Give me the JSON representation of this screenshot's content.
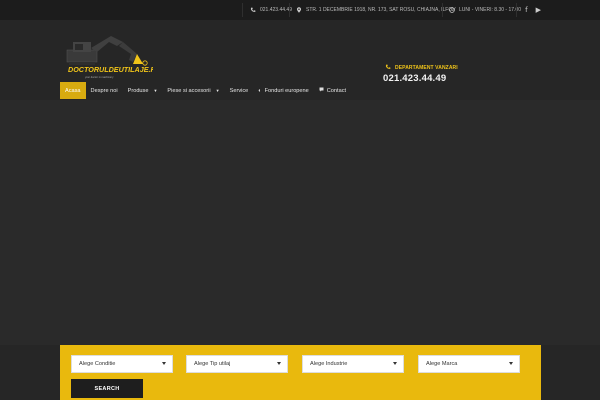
{
  "topbar": {
    "phone": "021.423.44.49",
    "address": "STR. 1 DECEMBRIE 1918, NR. 173, SAT ROSU, CHIAJNA, ILFOV",
    "hours": "LUNI - VINERI: 8.30 - 17.00",
    "social": [
      {
        "icon": "facebook-icon",
        "glyph": "f"
      },
      {
        "icon": "youtube-icon",
        "glyph": "▶"
      }
    ]
  },
  "header": {
    "logo_text": "DOCTORULDEUTILAJE.RO",
    "logo_tagline": "your doctor in machinery",
    "department_label": "DEPARTAMENT VANZARI",
    "department_phone": "021.423.44.49"
  },
  "nav": {
    "items": [
      {
        "label": "Acasa",
        "active": true
      },
      {
        "label": "Despre noi"
      },
      {
        "label": "Produse",
        "dropdown": true
      },
      {
        "label": "Piese si accesorii",
        "dropdown": true
      },
      {
        "label": "Service"
      },
      {
        "label": "Fonduri europene",
        "icon": "half-circle-icon"
      },
      {
        "label": "Contact",
        "icon": "chat-icon"
      }
    ]
  },
  "search": {
    "selects": [
      "Alege Conditie",
      "Alege Tip utilaj",
      "Alege Industrie",
      "Alege Marca"
    ],
    "button_label": "SEARCH"
  },
  "colors": {
    "accent": "#e9b90d",
    "nav_active": "#d8ab10",
    "background": "#262626",
    "topbar": "#1c1c1c"
  }
}
